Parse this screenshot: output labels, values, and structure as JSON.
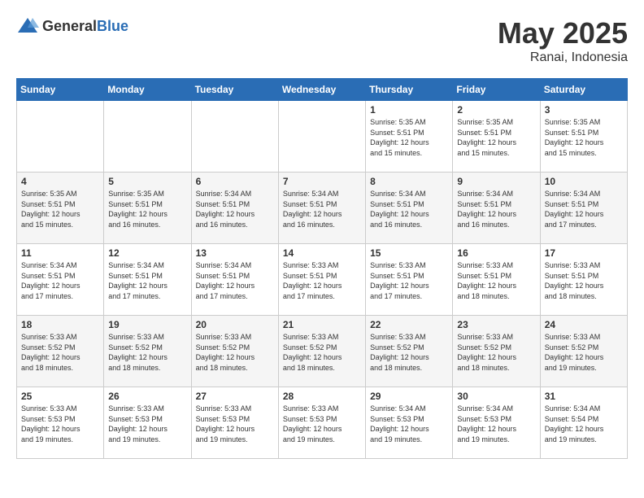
{
  "header": {
    "logo_general": "General",
    "logo_blue": "Blue",
    "month": "May 2025",
    "location": "Ranai, Indonesia"
  },
  "days_of_week": [
    "Sunday",
    "Monday",
    "Tuesday",
    "Wednesday",
    "Thursday",
    "Friday",
    "Saturday"
  ],
  "weeks": [
    {
      "days": [
        {
          "num": "",
          "info": ""
        },
        {
          "num": "",
          "info": ""
        },
        {
          "num": "",
          "info": ""
        },
        {
          "num": "",
          "info": ""
        },
        {
          "num": "1",
          "info": "Sunrise: 5:35 AM\nSunset: 5:51 PM\nDaylight: 12 hours\nand 15 minutes."
        },
        {
          "num": "2",
          "info": "Sunrise: 5:35 AM\nSunset: 5:51 PM\nDaylight: 12 hours\nand 15 minutes."
        },
        {
          "num": "3",
          "info": "Sunrise: 5:35 AM\nSunset: 5:51 PM\nDaylight: 12 hours\nand 15 minutes."
        }
      ]
    },
    {
      "days": [
        {
          "num": "4",
          "info": "Sunrise: 5:35 AM\nSunset: 5:51 PM\nDaylight: 12 hours\nand 15 minutes."
        },
        {
          "num": "5",
          "info": "Sunrise: 5:35 AM\nSunset: 5:51 PM\nDaylight: 12 hours\nand 16 minutes."
        },
        {
          "num": "6",
          "info": "Sunrise: 5:34 AM\nSunset: 5:51 PM\nDaylight: 12 hours\nand 16 minutes."
        },
        {
          "num": "7",
          "info": "Sunrise: 5:34 AM\nSunset: 5:51 PM\nDaylight: 12 hours\nand 16 minutes."
        },
        {
          "num": "8",
          "info": "Sunrise: 5:34 AM\nSunset: 5:51 PM\nDaylight: 12 hours\nand 16 minutes."
        },
        {
          "num": "9",
          "info": "Sunrise: 5:34 AM\nSunset: 5:51 PM\nDaylight: 12 hours\nand 16 minutes."
        },
        {
          "num": "10",
          "info": "Sunrise: 5:34 AM\nSunset: 5:51 PM\nDaylight: 12 hours\nand 17 minutes."
        }
      ]
    },
    {
      "days": [
        {
          "num": "11",
          "info": "Sunrise: 5:34 AM\nSunset: 5:51 PM\nDaylight: 12 hours\nand 17 minutes."
        },
        {
          "num": "12",
          "info": "Sunrise: 5:34 AM\nSunset: 5:51 PM\nDaylight: 12 hours\nand 17 minutes."
        },
        {
          "num": "13",
          "info": "Sunrise: 5:34 AM\nSunset: 5:51 PM\nDaylight: 12 hours\nand 17 minutes."
        },
        {
          "num": "14",
          "info": "Sunrise: 5:33 AM\nSunset: 5:51 PM\nDaylight: 12 hours\nand 17 minutes."
        },
        {
          "num": "15",
          "info": "Sunrise: 5:33 AM\nSunset: 5:51 PM\nDaylight: 12 hours\nand 17 minutes."
        },
        {
          "num": "16",
          "info": "Sunrise: 5:33 AM\nSunset: 5:51 PM\nDaylight: 12 hours\nand 18 minutes."
        },
        {
          "num": "17",
          "info": "Sunrise: 5:33 AM\nSunset: 5:51 PM\nDaylight: 12 hours\nand 18 minutes."
        }
      ]
    },
    {
      "days": [
        {
          "num": "18",
          "info": "Sunrise: 5:33 AM\nSunset: 5:52 PM\nDaylight: 12 hours\nand 18 minutes."
        },
        {
          "num": "19",
          "info": "Sunrise: 5:33 AM\nSunset: 5:52 PM\nDaylight: 12 hours\nand 18 minutes."
        },
        {
          "num": "20",
          "info": "Sunrise: 5:33 AM\nSunset: 5:52 PM\nDaylight: 12 hours\nand 18 minutes."
        },
        {
          "num": "21",
          "info": "Sunrise: 5:33 AM\nSunset: 5:52 PM\nDaylight: 12 hours\nand 18 minutes."
        },
        {
          "num": "22",
          "info": "Sunrise: 5:33 AM\nSunset: 5:52 PM\nDaylight: 12 hours\nand 18 minutes."
        },
        {
          "num": "23",
          "info": "Sunrise: 5:33 AM\nSunset: 5:52 PM\nDaylight: 12 hours\nand 18 minutes."
        },
        {
          "num": "24",
          "info": "Sunrise: 5:33 AM\nSunset: 5:52 PM\nDaylight: 12 hours\nand 19 minutes."
        }
      ]
    },
    {
      "days": [
        {
          "num": "25",
          "info": "Sunrise: 5:33 AM\nSunset: 5:53 PM\nDaylight: 12 hours\nand 19 minutes."
        },
        {
          "num": "26",
          "info": "Sunrise: 5:33 AM\nSunset: 5:53 PM\nDaylight: 12 hours\nand 19 minutes."
        },
        {
          "num": "27",
          "info": "Sunrise: 5:33 AM\nSunset: 5:53 PM\nDaylight: 12 hours\nand 19 minutes."
        },
        {
          "num": "28",
          "info": "Sunrise: 5:33 AM\nSunset: 5:53 PM\nDaylight: 12 hours\nand 19 minutes."
        },
        {
          "num": "29",
          "info": "Sunrise: 5:34 AM\nSunset: 5:53 PM\nDaylight: 12 hours\nand 19 minutes."
        },
        {
          "num": "30",
          "info": "Sunrise: 5:34 AM\nSunset: 5:53 PM\nDaylight: 12 hours\nand 19 minutes."
        },
        {
          "num": "31",
          "info": "Sunrise: 5:34 AM\nSunset: 5:54 PM\nDaylight: 12 hours\nand 19 minutes."
        }
      ]
    }
  ]
}
